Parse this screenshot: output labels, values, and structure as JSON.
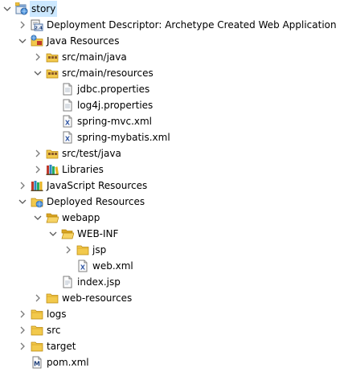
{
  "project_explorer": {
    "items": [
      {
        "label": "story",
        "level": 0,
        "toggle": "expanded",
        "icon": "web-project-icon",
        "selected": true
      },
      {
        "label": "Deployment Descriptor: Archetype Created Web Application",
        "level": 1,
        "toggle": "collapsed",
        "icon": "deployment-descriptor-icon"
      },
      {
        "label": "Java Resources",
        "level": 1,
        "toggle": "expanded",
        "icon": "java-resources-icon"
      },
      {
        "label": "src/main/java",
        "level": 2,
        "toggle": "collapsed",
        "icon": "source-folder-icon"
      },
      {
        "label": "src/main/resources",
        "level": 2,
        "toggle": "expanded",
        "icon": "source-folder-icon"
      },
      {
        "label": "jdbc.properties",
        "level": 3,
        "toggle": "none",
        "icon": "properties-file-icon"
      },
      {
        "label": "log4j.properties",
        "level": 3,
        "toggle": "none",
        "icon": "properties-file-icon"
      },
      {
        "label": "spring-mvc.xml",
        "level": 3,
        "toggle": "none",
        "icon": "xml-file-icon"
      },
      {
        "label": "spring-mybatis.xml",
        "level": 3,
        "toggle": "none",
        "icon": "xml-file-icon"
      },
      {
        "label": "src/test/java",
        "level": 2,
        "toggle": "collapsed",
        "icon": "source-folder-icon"
      },
      {
        "label": "Libraries",
        "level": 2,
        "toggle": "collapsed",
        "icon": "libraries-icon"
      },
      {
        "label": "JavaScript Resources",
        "level": 1,
        "toggle": "collapsed",
        "icon": "javascript-resources-icon"
      },
      {
        "label": "Deployed Resources",
        "level": 1,
        "toggle": "expanded",
        "icon": "deployed-resources-icon"
      },
      {
        "label": "webapp",
        "level": 2,
        "toggle": "expanded",
        "icon": "folder-open-icon"
      },
      {
        "label": "WEB-INF",
        "level": 3,
        "toggle": "expanded",
        "icon": "folder-open-icon"
      },
      {
        "label": "jsp",
        "level": 4,
        "toggle": "collapsed",
        "icon": "folder-icon"
      },
      {
        "label": "web.xml",
        "level": 4,
        "toggle": "none",
        "icon": "xml-file-icon"
      },
      {
        "label": "index.jsp",
        "level": 3,
        "toggle": "none",
        "icon": "jsp-file-icon"
      },
      {
        "label": "web-resources",
        "level": 2,
        "toggle": "collapsed",
        "icon": "folder-icon"
      },
      {
        "label": "logs",
        "level": 1,
        "toggle": "collapsed",
        "icon": "folder-icon"
      },
      {
        "label": "src",
        "level": 1,
        "toggle": "collapsed",
        "icon": "folder-icon"
      },
      {
        "label": "target",
        "level": 1,
        "toggle": "collapsed",
        "icon": "folder-icon"
      },
      {
        "label": "pom.xml",
        "level": 1,
        "toggle": "none",
        "icon": "maven-pom-icon"
      }
    ]
  },
  "colors": {
    "selection": "#cce8ff",
    "folder_yellow": "#f2c94c",
    "folder_dark": "#d9a423",
    "toggle_grey": "#7a7a7a"
  }
}
